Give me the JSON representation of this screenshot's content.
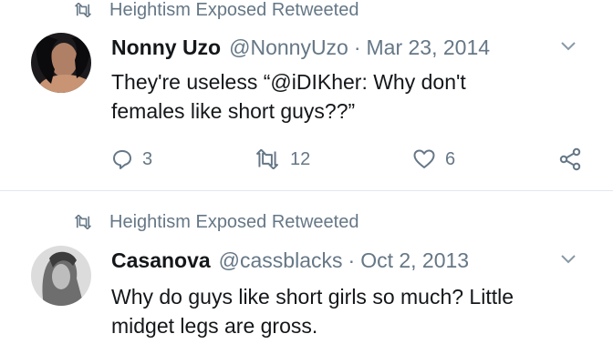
{
  "tweets": [
    {
      "retweeted_by": "Heightism Exposed Retweeted",
      "name": "Nonny Uzo",
      "handle": "@NonnyUzo",
      "separator": "·",
      "date": "Mar 23, 2014",
      "text_line1": "They're useless “@iDIKher: Why don't",
      "text_line2": "females like short guys??”",
      "replies": "3",
      "retweets": "12",
      "likes": "6"
    },
    {
      "retweeted_by": "Heightism Exposed Retweeted",
      "name": "Casanova",
      "handle": "@cassblacks",
      "separator": "·",
      "date": "Oct 2, 2013",
      "text_line1": "Why do guys like short girls so much? Little",
      "text_line2": "midget legs are gross."
    }
  ],
  "icons": {
    "retweet": "retweet-icon",
    "reply": "reply-icon",
    "like": "heart-icon",
    "share": "share-icon",
    "more": "chevron-down-icon"
  },
  "colors": {
    "text_primary": "#14171a",
    "text_secondary": "#657786",
    "divider": "#e1e8ed"
  }
}
